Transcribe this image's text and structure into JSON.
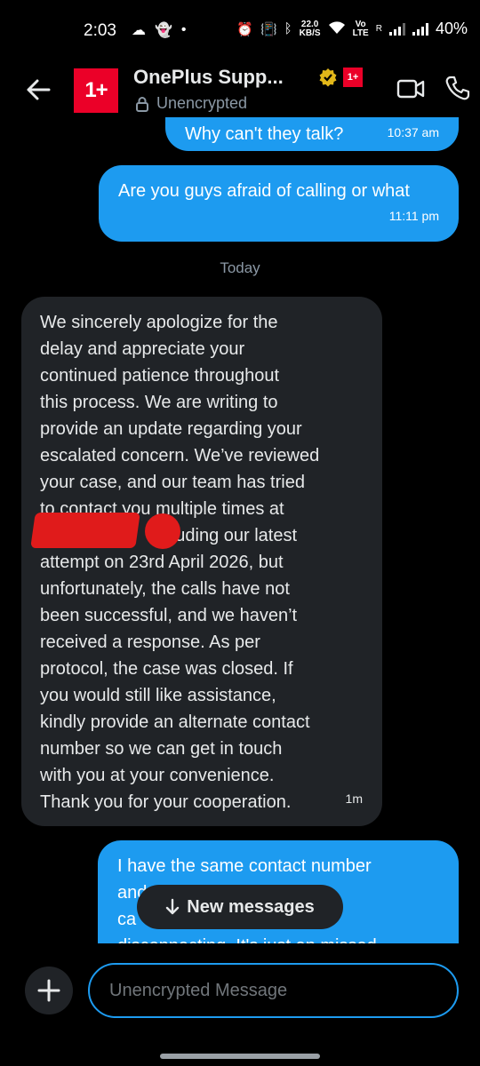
{
  "status_bar": {
    "time": "2:03",
    "speed_value": "22.0",
    "speed_unit": "KB/S",
    "network_tag_1": "Vo",
    "network_tag_2": "LTE",
    "sim_tag": "R",
    "battery": "40%"
  },
  "header": {
    "logo_text": "1+",
    "mini_logo_text": "1+",
    "name": "OnePlus Supp...",
    "subtitle": "Unencrypted"
  },
  "messages": {
    "partial_top_text": "Why can't they talk?",
    "partial_top_time": "10:37 am",
    "out_1_text": "Are you guys afraid of calling or what",
    "out_1_time": "11:11 pm",
    "day_separator": "Today",
    "in_1_lines": [
      "We sincerely apologize for the",
      "delay and appreciate your",
      "continued patience throughout",
      "this process. We are writing to",
      "provide an update regarding your",
      "escalated concern. We’ve reviewed",
      "your case, and our team has tried",
      "to contact you multiple times at",
      "          07        including our latest",
      "attempt on 23rd April 2026, but",
      "unfortunately, the calls have not",
      "been successful, and we haven’t",
      "received a response. As per",
      "protocol, the case was closed. If",
      "you would still like assistance,",
      "kindly provide an alternate contact",
      "number so we can get in touch",
      "with you at your convenience.",
      "Thank you for your cooperation."
    ],
    "in_1_time": "1m",
    "out_2_lines": [
      "I have the same contact number",
      "and              is not even",
      "ca",
      "disconnecting. It's just an missed"
    ]
  },
  "new_messages_label": "New messages",
  "composer": {
    "placeholder": "Unencrypted Message"
  },
  "colors": {
    "accent": "#1d9bf0",
    "brand": "#eb0028",
    "incoming_bubble": "#202327",
    "background": "#000000"
  }
}
